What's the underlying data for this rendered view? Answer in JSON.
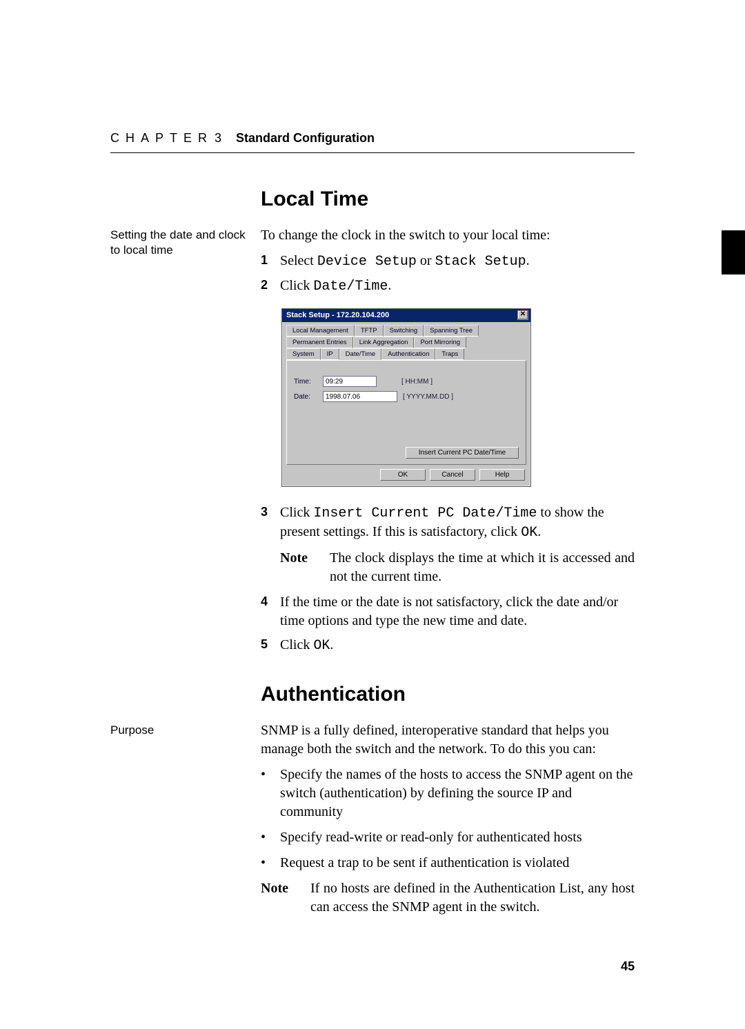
{
  "header": {
    "chapter_word": "CHAPTER",
    "chapter_num": "3",
    "chapter_title": "Standard Configuration"
  },
  "thumb_tab": {
    "present": true
  },
  "section_local_time": {
    "heading": "Local Time",
    "margin_note": "Setting the date and clock to local time",
    "intro": "To change the clock in the switch to your local time:",
    "steps_top": [
      {
        "n": "1",
        "pre": "Select ",
        "code": "Device Setup",
        "mid": " or ",
        "code2": "Stack Setup",
        "post": "."
      },
      {
        "n": "2",
        "pre": "Click ",
        "code": "Date/Time",
        "post": "."
      }
    ],
    "step3": {
      "n": "3",
      "pre": "Click ",
      "code": "Insert Current PC Date/Time",
      "mid": " to show the present settings. If this is satisfactory, click ",
      "code2": "OK",
      "post": "."
    },
    "step3_note": {
      "label": "Note",
      "text": "The clock displays the time at which it is accessed and not the current time."
    },
    "step4": {
      "n": "4",
      "text": "If the time or the date is not satisfactory, click the date and/or time options and type the new time and date."
    },
    "step5": {
      "n": "5",
      "pre": "Click ",
      "code": "OK",
      "post": "."
    }
  },
  "dialog": {
    "title": "Stack Setup - 172.20.104.200",
    "close_glyph": "✕",
    "tabs_row1": [
      "Local Management",
      "TFTP",
      "Switching",
      "Spanning Tree"
    ],
    "tabs_row2": [
      "Permanent Entries",
      "Link Aggregation",
      "Port Mirroring"
    ],
    "tabs_row3": [
      "System",
      "IP",
      "Date/Time",
      "Authentication",
      "Traps"
    ],
    "active_tab": "Date/Time",
    "time_label": "Time:",
    "time_value": "09:29",
    "time_hint": "[ HH:MM ]",
    "date_label": "Date:",
    "date_value": "1998.07.06",
    "date_hint": "[ YYYY.MM.DD ]",
    "insert_button": "Insert Current PC Date/Time",
    "ok": "OK",
    "cancel": "Cancel",
    "help": "Help"
  },
  "section_auth": {
    "heading": "Authentication",
    "margin_note": "Purpose",
    "intro": "SNMP is a fully defined, interoperative standard that helps you manage both the switch and the network. To do this you can:",
    "bullets": [
      "Specify the names of the hosts to access the SNMP agent on the switch (authentication) by defining the source IP and community",
      "Specify read-write or read-only for authenticated hosts",
      "Request a trap to be sent if authentication is violated"
    ],
    "note": {
      "label": "Note",
      "text": "If no hosts are defined in the Authentication List, any host can access the SNMP agent in the switch."
    }
  },
  "page_number": "45"
}
